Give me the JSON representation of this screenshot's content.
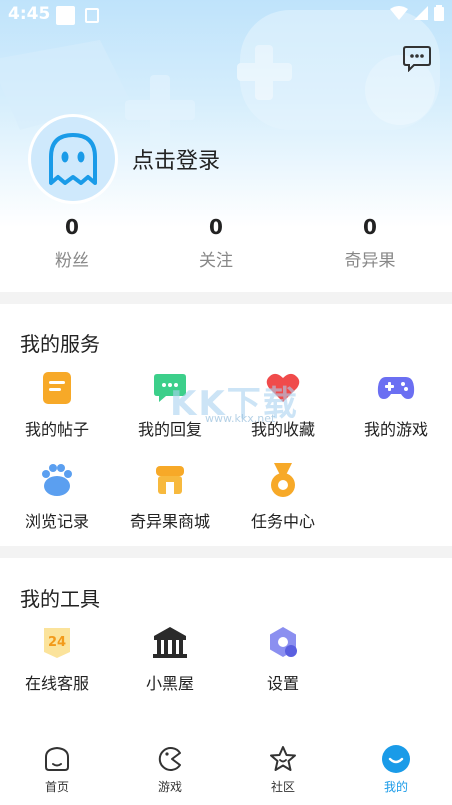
{
  "status_bar": {
    "time": "4:45"
  },
  "profile": {
    "login_text": "点击登录"
  },
  "stats": [
    {
      "value": "0",
      "label": "粉丝"
    },
    {
      "value": "0",
      "label": "关注"
    },
    {
      "value": "0",
      "label": "奇异果"
    }
  ],
  "services": {
    "title": "我的服务",
    "items": [
      {
        "label": "我的帖子",
        "icon": "post-icon"
      },
      {
        "label": "我的回复",
        "icon": "reply-icon"
      },
      {
        "label": "我的收藏",
        "icon": "favorite-icon"
      },
      {
        "label": "我的游戏",
        "icon": "gamepad-icon"
      },
      {
        "label": "浏览记录",
        "icon": "history-icon"
      },
      {
        "label": "奇异果商城",
        "icon": "shop-icon"
      },
      {
        "label": "任务中心",
        "icon": "medal-icon"
      }
    ]
  },
  "tools": {
    "title": "我的工具",
    "items": [
      {
        "label": "在线客服",
        "icon": "service-24-icon"
      },
      {
        "label": "小黑屋",
        "icon": "jail-house-icon"
      },
      {
        "label": "设置",
        "icon": "settings-icon"
      }
    ]
  },
  "watermark": {
    "main": "KK下载",
    "sub": "www.kkx.net"
  },
  "nav": [
    {
      "label": "首页",
      "icon": "home-icon"
    },
    {
      "label": "游戏",
      "icon": "game-icon"
    },
    {
      "label": "社区",
      "icon": "community-icon"
    },
    {
      "label": "我的",
      "icon": "mine-icon",
      "active": true
    }
  ],
  "colors": {
    "accent": "#1a9be8",
    "orange": "#f7a928",
    "green": "#3ccf8a",
    "red": "#f04b4b",
    "purple": "#6b6ff2"
  }
}
